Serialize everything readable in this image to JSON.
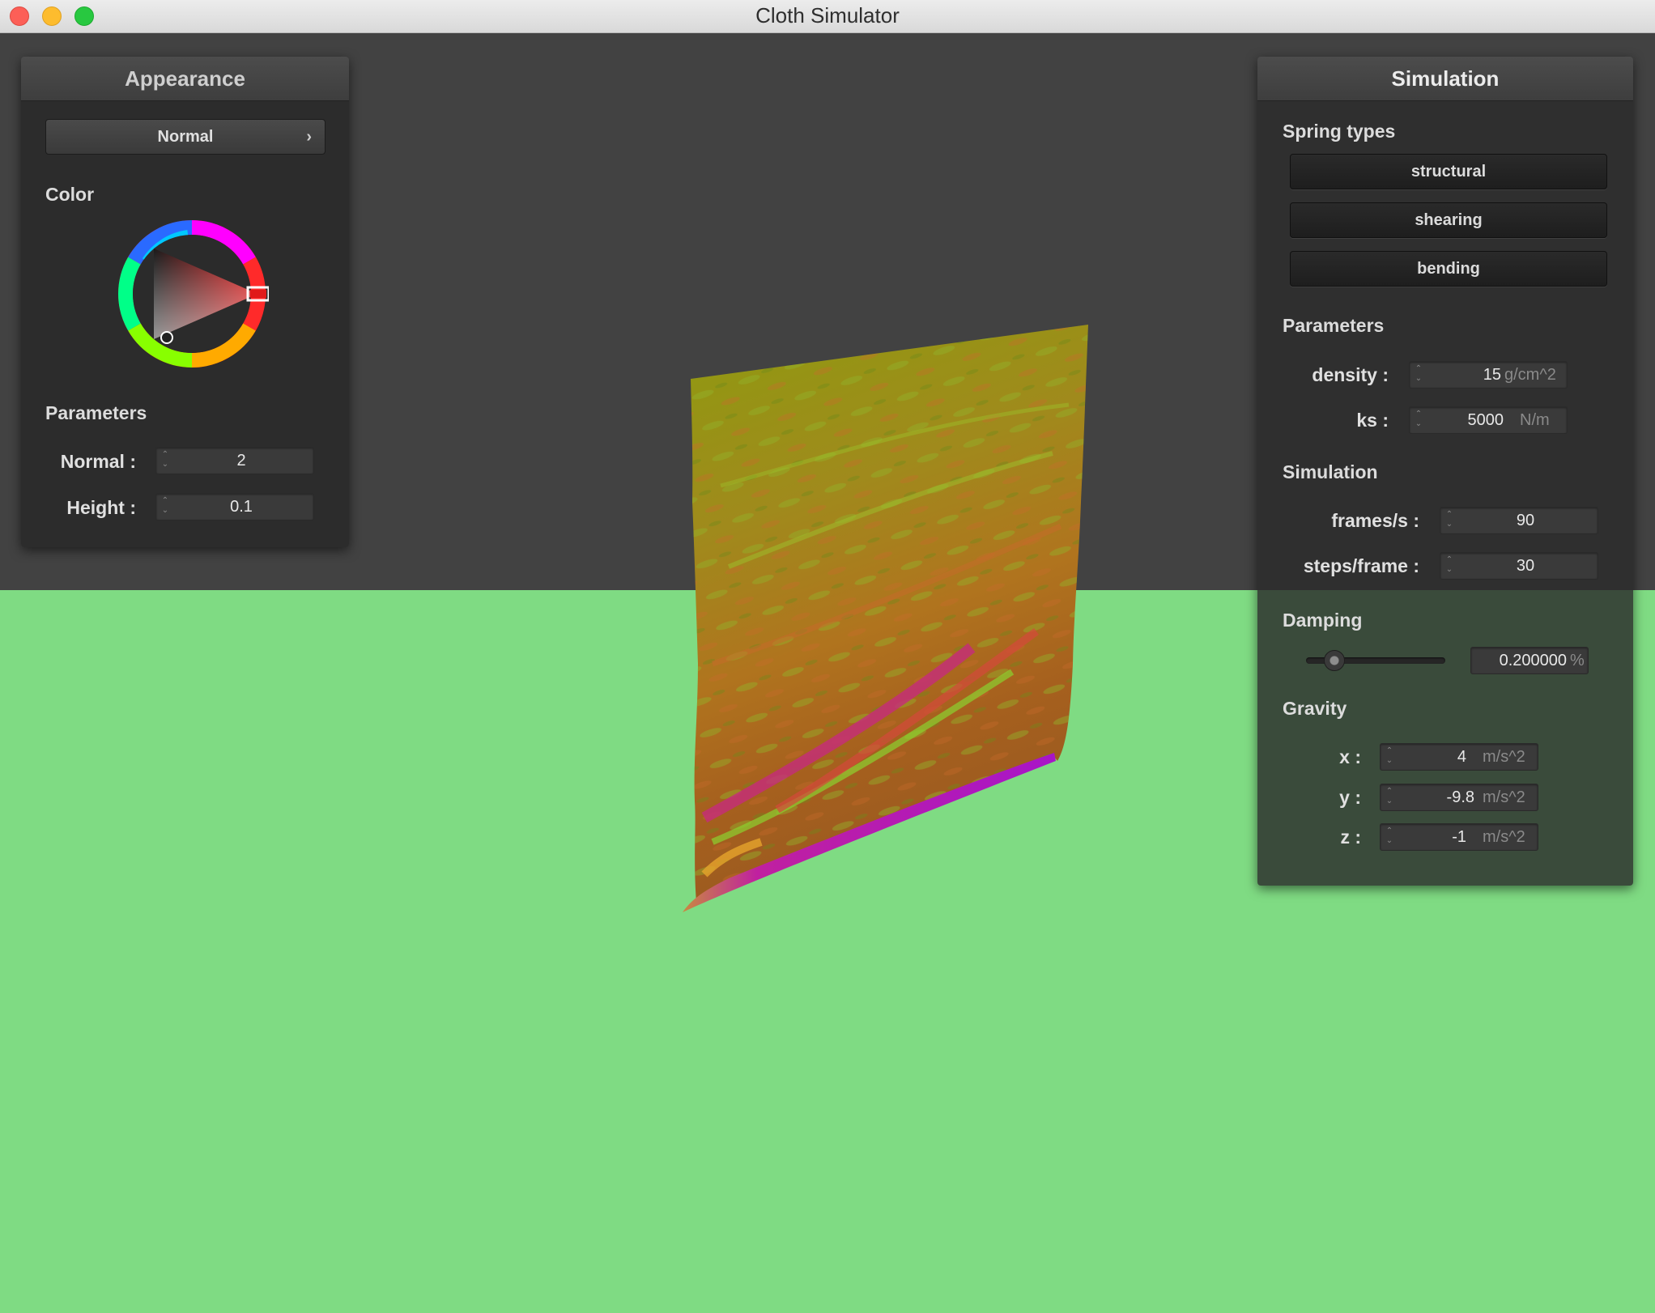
{
  "window": {
    "title": "Cloth Simulator"
  },
  "appearance": {
    "header": "Appearance",
    "shader_select": "Normal",
    "color_label": "Color",
    "color_accent": "#e01a1a",
    "parameters_label": "Parameters",
    "fields": [
      {
        "label": "Normal :",
        "value": "2"
      },
      {
        "label": "Height :",
        "value": "0.1"
      }
    ]
  },
  "simulation": {
    "header": "Simulation",
    "spring_types_label": "Spring types",
    "spring_buttons": [
      "structural",
      "shearing",
      "bending"
    ],
    "parameters_label": "Parameters",
    "density": {
      "label": "density :",
      "value": "15",
      "unit": "g/cm^2"
    },
    "ks": {
      "label": "ks :",
      "value": "5000",
      "unit": "N/m"
    },
    "simulation_label": "Simulation",
    "frames": {
      "label": "frames/s :",
      "value": "90"
    },
    "steps": {
      "label": "steps/frame :",
      "value": "30"
    },
    "damping_label": "Damping",
    "damping": {
      "value": "0.200000",
      "unit": "%",
      "slider_fraction": 0.2
    },
    "gravity_label": "Gravity",
    "gravity": [
      {
        "label": "x :",
        "value": "4",
        "unit": "m/s^2"
      },
      {
        "label": "y :",
        "value": "-9.8",
        "unit": "m/s^2"
      },
      {
        "label": "z :",
        "value": "-1",
        "unit": "m/s^2"
      }
    ]
  },
  "scene": {
    "sky_color": "#424242",
    "ground_color": "#7fdb83"
  }
}
